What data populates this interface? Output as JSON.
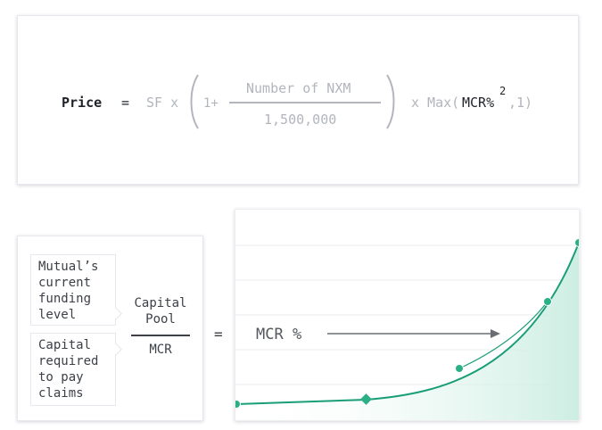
{
  "formula": {
    "price": "Price",
    "equals": "=",
    "sf_x": "SF x",
    "one_plus": "1+",
    "numerator": "Number of NXM",
    "denominator": "1,500,000",
    "x_max_open": "x Max(",
    "mcr_pct": "MCR%",
    "exponent": "2",
    "tail": ",1)"
  },
  "ratio": {
    "top_box_lines": [
      "Mutual’s",
      "current",
      "funding",
      "level"
    ],
    "bottom_box_lines": [
      "Capital",
      "required",
      "to pay",
      "claims"
    ],
    "numerator_lines": [
      "Capital",
      "Pool"
    ],
    "denominator": "MCR",
    "equals": "="
  },
  "chart": {
    "arrow_label": "MCR %",
    "colors": {
      "curve": "#1a9e78",
      "fill": "#d8f1e8",
      "grid": "#e8ebef",
      "arrow": "#6a6e74"
    }
  }
}
